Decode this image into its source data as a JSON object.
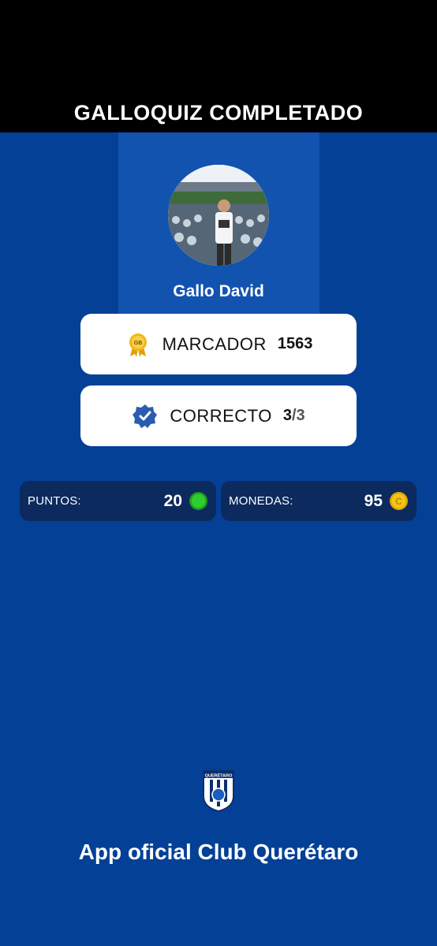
{
  "header": {
    "title": "GALLOQUIZ COMPLETADO"
  },
  "profile": {
    "name": "Gallo David",
    "avatar_icon": "user-photo"
  },
  "stats": {
    "score": {
      "icon": "gb-award-icon",
      "label": "MARCADOR",
      "value": "1563"
    },
    "correct": {
      "icon": "verified-badge-icon",
      "label": "CORRECTO",
      "value_main": "3",
      "value_total": "/3"
    }
  },
  "rewards": {
    "points": {
      "label": "PUNTOS:",
      "value": "20",
      "icon": "green-dot-icon"
    },
    "coins": {
      "label": "MONEDAS:",
      "value": "95",
      "icon": "coin-icon"
    }
  },
  "footer": {
    "crest_icon": "club-queretaro-crest",
    "crest_text": "QUERÉTARO",
    "text": "App oficial Club Querétaro"
  },
  "colors": {
    "background": "#034096",
    "header": "#000000",
    "card": "#ffffff",
    "pill": "#0c2a5d",
    "badge_blue": "#2a5db0",
    "award_gold": "#f2b619",
    "points_green": "#2ecc2e",
    "coin_gold": "#f5c518"
  }
}
